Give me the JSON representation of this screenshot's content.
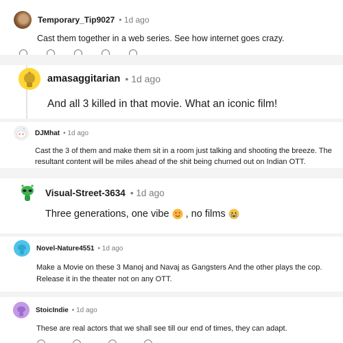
{
  "comments": [
    {
      "username": "Temporary_Tip9027",
      "separator": "•",
      "time": "1d ago",
      "text": "Cast them together in a web series. See how internet goes crazy."
    },
    {
      "username": "amasaggitarian",
      "separator": "•",
      "time": "1d ago",
      "text": "And all 3 killed in that movie. What an iconic film!"
    },
    {
      "username": "DJMhat",
      "separator": "•",
      "time": "1d ago",
      "text": "Cast the 3 of them and make them sit in a room just talking and shooting the breeze. The resultant content will be miles ahead of the shit being churned out on Indian OTT."
    },
    {
      "username": "Visual-Street-3634",
      "separator": "•",
      "time": "1d ago",
      "text_part1": "Three generations, one vibe",
      "text_part2": ", no films",
      "emojis": [
        "heart-eyes-emoji",
        "crying-emoji"
      ]
    },
    {
      "username": "Novel-Nature4551",
      "separator": "•",
      "time": "1d ago",
      "text": "Make a Movie on these 3 Manoj and Navaj as Gangsters And the other plays the cop. Release it in the theater not on any OTT."
    },
    {
      "username": "StoicIndie",
      "separator": "•",
      "time": "1d ago",
      "text": "These are real actors that we shall see till our end of times, they can adapt."
    }
  ],
  "colors": {
    "background": "#f3f3f4",
    "card": "#ffffff",
    "meta": "#7c7c7c",
    "thread_line": "#e2e2e2"
  }
}
